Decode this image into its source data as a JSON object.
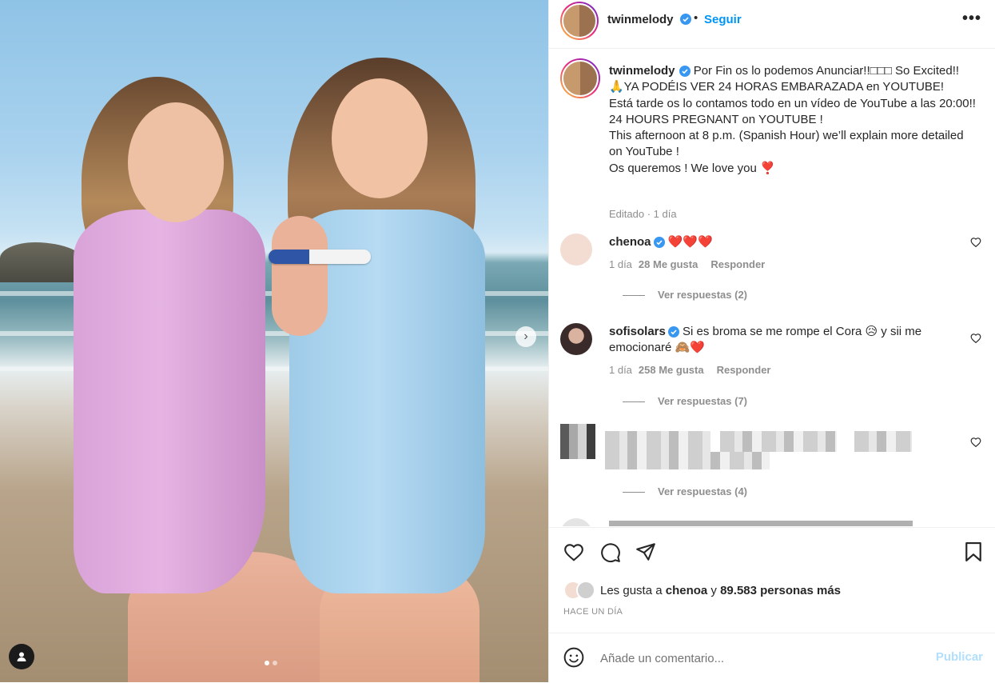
{
  "post": {
    "username": "twinmelody",
    "follow_label": "Seguir",
    "separator": "•",
    "more_label": "•••"
  },
  "caption": {
    "username": "twinmelody",
    "lines": [
      "Por Fin os lo podemos Anunciar!!□□□ So Excited!!",
      "🙏YA PODÉIS VER 24 HORAS EMBARAZADA en YOUTUBE!",
      "Está tarde os lo contamos todo en un vídeo de YouTube a las 20:00!!",
      "24 HOURS PREGNANT on YOUTUBE !",
      "This afternoon at 8 p.m. (Spanish Hour) we’ll explain more detailed on YouTube !",
      "Os queremos ! We love you ❣️"
    ],
    "meta": "Editado · 1 día"
  },
  "comments": [
    {
      "username": "chenoa",
      "text": "❤️❤️❤️",
      "time": "1 día",
      "likes": "28 Me gusta",
      "reply_label": "Responder",
      "replies": "Ver respuestas (2)",
      "avatar_color": "#f3ddd2"
    },
    {
      "username": "sofisolars",
      "text": "Si es broma se me rompe el Cora 😥 y sii me emocionaré 🙈❤️",
      "time": "1 día",
      "likes": "258 Me gusta",
      "reply_label": "Responder",
      "replies": "Ver respuestas (7)",
      "avatar_color": "#3a2a2a"
    },
    {
      "username": "",
      "text": "",
      "replies": "Ver respuestas (4)"
    }
  ],
  "likes": {
    "prefix": "Les gusta a ",
    "first_user": "chenoa",
    "middle": " y ",
    "rest": "89.583 personas más"
  },
  "timestamp": "HACE UN DÍA",
  "composer": {
    "placeholder": "Añade un comentario...",
    "publish_label": "Publicar"
  },
  "icons": {
    "verified": "verified-badge-icon",
    "like": "heart-icon",
    "comment": "comment-icon",
    "share": "send-icon",
    "save": "bookmark-icon",
    "emoji": "emoji-icon",
    "next": "chevron-right-icon",
    "tag": "user-tag-icon"
  },
  "colors": {
    "link": "#0095f6",
    "publish_disabled": "#b2dffc",
    "secondary_text": "#8e8e8e",
    "verified": "#3897f0"
  }
}
